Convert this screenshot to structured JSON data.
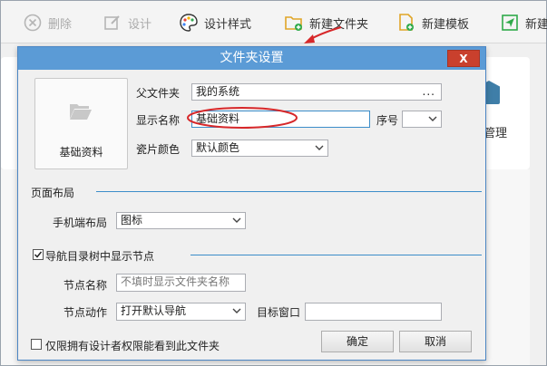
{
  "toolbar": {
    "delete_label": "删除",
    "design_label": "设计",
    "design_style_label": "设计样式",
    "new_folder_label": "新建文件夹",
    "new_template_label": "新建模板",
    "new_more_label": "新建"
  },
  "background": {
    "card_right_text": "管理"
  },
  "dialog": {
    "title": "文件夹设置",
    "close_label": "X",
    "tile_label": "基础资料",
    "parent_folder_label": "父文件夹",
    "parent_folder_value": "我的系统",
    "parent_folder_browse": "...",
    "display_name_label": "显示名称",
    "display_name_value": "基础资料",
    "seq_label": "序号",
    "seq_value": "",
    "tile_color_label": "瓷片颜色",
    "tile_color_value": "默认颜色",
    "page_layout_title": "页面布局",
    "mobile_layout_label": "手机端布局",
    "mobile_layout_value": "图标",
    "show_in_nav_label": "导航目录树中显示节点",
    "node_name_label": "节点名称",
    "node_name_placeholder": "不填时显示文件夹名称",
    "node_action_label": "节点动作",
    "node_action_value": "打开默认导航",
    "target_window_label": "目标窗口",
    "target_window_value": "",
    "designer_only_label": "仅限拥有设计者权限能看到此文件夹",
    "ok_label": "确定",
    "cancel_label": "取消"
  },
  "colors": {
    "title_bar": "#5b9bd6",
    "close_button": "#c9402d",
    "section_line": "#3c8dc9",
    "annotation_red": "#d7282a"
  }
}
